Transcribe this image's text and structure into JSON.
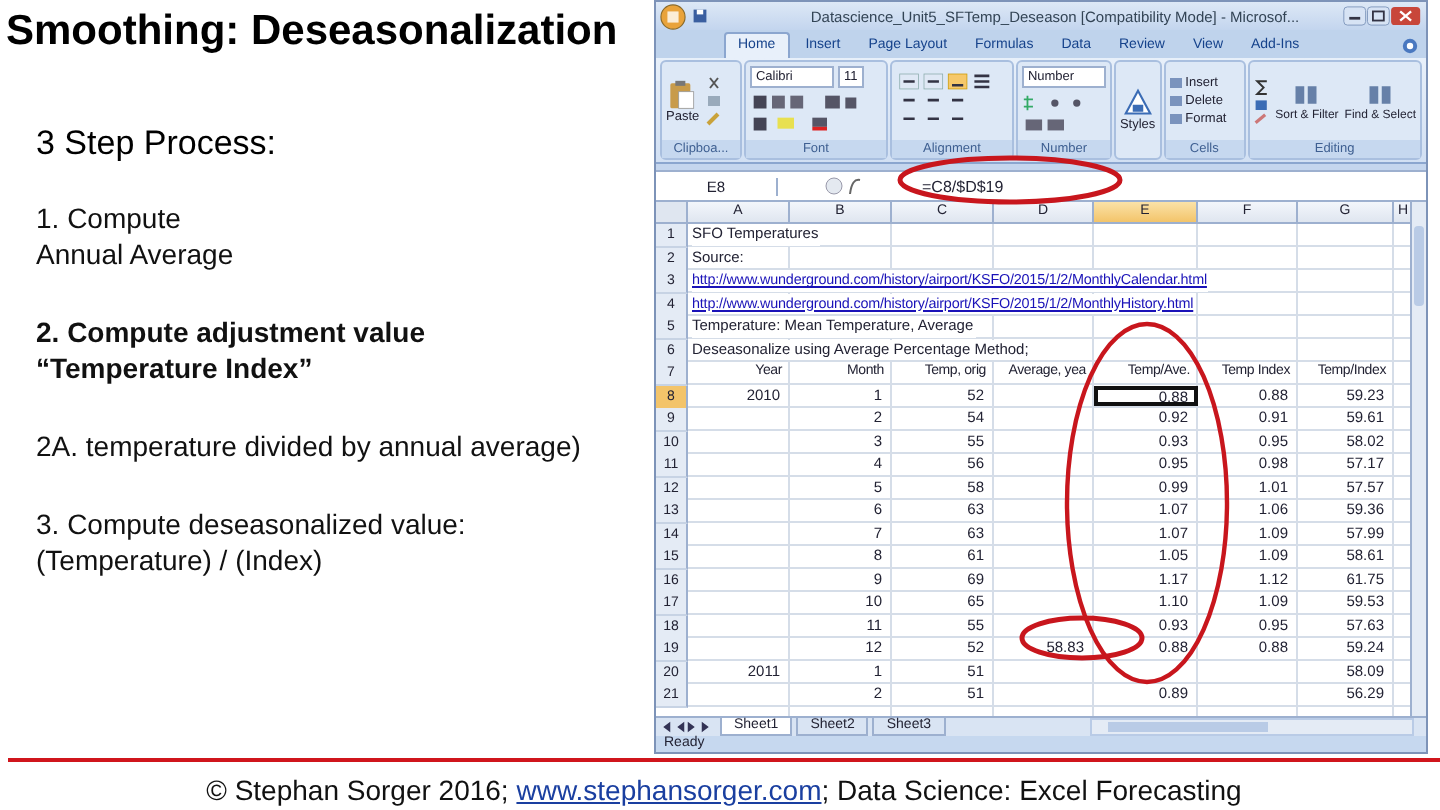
{
  "slide": {
    "title": "Smoothing: Deseasonalization",
    "heading": "3 Step Process:",
    "steps": [
      {
        "lines": [
          "1. Compute",
          "Annual Average"
        ],
        "bold": false
      },
      {
        "lines": [
          "2. Compute adjustment value",
          "“Temperature Index”"
        ],
        "bold": true
      },
      {
        "lines": [
          "2A. temperature divided by annual average)"
        ],
        "bold": false
      },
      {
        "lines": [
          "3. Compute deseasonalized value:",
          "(Temperature) /  (Index)"
        ],
        "bold": false
      }
    ]
  },
  "excel": {
    "title": "Datascience_Unit5_SFTemp_Deseason  [Compatibility Mode] - Microsof...",
    "tabs": [
      {
        "label": "Home",
        "selected": true
      },
      {
        "label": "Insert",
        "selected": false
      },
      {
        "label": "Page Layout",
        "selected": false
      },
      {
        "label": "Formulas",
        "selected": false
      },
      {
        "label": "Data",
        "selected": false
      },
      {
        "label": "Review",
        "selected": false
      },
      {
        "label": "View",
        "selected": false
      },
      {
        "label": "Add-Ins",
        "selected": false
      }
    ],
    "ribbon": [
      {
        "kind": "clipboard",
        "label": "Clipboa...",
        "button": "Paste"
      },
      {
        "kind": "font",
        "label": "Font",
        "font": "Calibri",
        "size": "11"
      },
      {
        "kind": "alignment",
        "label": "Alignment"
      },
      {
        "kind": "number",
        "label": "Number",
        "format": "Number"
      },
      {
        "kind": "styles",
        "button": "Styles"
      },
      {
        "kind": "cells",
        "label": "Cells",
        "buttons": [
          "Insert",
          "Delete",
          "Format"
        ]
      },
      {
        "kind": "editing",
        "label": "Editing",
        "buttons": [
          "Sort & Filter",
          "Find & Select"
        ]
      }
    ],
    "name_box": "E8",
    "formula": "=C8/$D$19",
    "columns": [
      {
        "label": "A",
        "selected": false
      },
      {
        "label": "B",
        "selected": false
      },
      {
        "label": "C",
        "selected": false
      },
      {
        "label": "D",
        "selected": false
      },
      {
        "label": "E",
        "selected": true
      },
      {
        "label": "F",
        "selected": false
      },
      {
        "label": "G",
        "selected": false
      },
      {
        "label": "H",
        "selected": false
      }
    ],
    "rows": [
      {
        "n": "1",
        "kind": "note",
        "selected": false,
        "A": "SFO Temperatures"
      },
      {
        "n": "2",
        "kind": "note",
        "selected": false,
        "A": "Source:"
      },
      {
        "n": "3",
        "kind": "link",
        "selected": false,
        "A": "http://www.wunderground.com/history/airport/KSFO/2015/1/2/MonthlyCalendar.html"
      },
      {
        "n": "4",
        "kind": "link",
        "selected": false,
        "A": "http://www.wunderground.com/history/airport/KSFO/2015/1/2/MonthlyHistory.html"
      },
      {
        "n": "5",
        "kind": "note",
        "selected": false,
        "A": "Temperature: Mean Temperature, Average"
      },
      {
        "n": "6",
        "kind": "note",
        "selected": false,
        "A": "Deseasonalize using Average Percentage Method;"
      },
      {
        "n": "7",
        "kind": "header",
        "selected": false,
        "A": "Year",
        "B": "Month",
        "C": "Temp, orig",
        "D": "Average, yea",
        "E": "Temp/Ave.",
        "F": "Temp Index",
        "G": "Temp/Index"
      },
      {
        "n": "8",
        "kind": "values",
        "selected": true,
        "A": "2010",
        "B": "1",
        "C": "52",
        "E": "0.88",
        "F": "0.88",
        "G": "59.23"
      },
      {
        "n": "9",
        "kind": "values",
        "selected": false,
        "B": "2",
        "C": "54",
        "E": "0.92",
        "F": "0.91",
        "G": "59.61"
      },
      {
        "n": "10",
        "kind": "values",
        "selected": false,
        "B": "3",
        "C": "55",
        "E": "0.93",
        "F": "0.95",
        "G": "58.02"
      },
      {
        "n": "11",
        "kind": "values",
        "selected": false,
        "B": "4",
        "C": "56",
        "E": "0.95",
        "F": "0.98",
        "G": "57.17"
      },
      {
        "n": "12",
        "kind": "values",
        "selected": false,
        "B": "5",
        "C": "58",
        "E": "0.99",
        "F": "1.01",
        "G": "57.57"
      },
      {
        "n": "13",
        "kind": "values",
        "selected": false,
        "B": "6",
        "C": "63",
        "E": "1.07",
        "F": "1.06",
        "G": "59.36"
      },
      {
        "n": "14",
        "kind": "values",
        "selected": false,
        "B": "7",
        "C": "63",
        "E": "1.07",
        "F": "1.09",
        "G": "57.99"
      },
      {
        "n": "15",
        "kind": "values",
        "selected": false,
        "B": "8",
        "C": "61",
        "E": "1.05",
        "F": "1.09",
        "G": "58.61"
      },
      {
        "n": "16",
        "kind": "values",
        "selected": false,
        "B": "9",
        "C": "69",
        "E": "1.17",
        "F": "1.12",
        "G": "61.75"
      },
      {
        "n": "17",
        "kind": "values",
        "selected": false,
        "B": "10",
        "C": "65",
        "E": "1.10",
        "F": "1.09",
        "G": "59.53"
      },
      {
        "n": "18",
        "kind": "values",
        "selected": false,
        "B": "11",
        "C": "55",
        "E": "0.93",
        "F": "0.95",
        "G": "57.63"
      },
      {
        "n": "19",
        "kind": "values",
        "selected": false,
        "B": "12",
        "C": "52",
        "D": "58.83",
        "E": "0.88",
        "F": "0.88",
        "G": "59.24"
      },
      {
        "n": "20",
        "kind": "values",
        "selected": false,
        "A": "2011",
        "B": "1",
        "C": "51",
        "G": "58.09"
      },
      {
        "n": "21",
        "kind": "values",
        "selected": false,
        "B": "2",
        "C": "51",
        "E": "0.89",
        "G": "56.29"
      }
    ],
    "sheets": [
      {
        "label": "Sheet1",
        "selected": true
      },
      {
        "label": "Sheet2",
        "selected": false
      },
      {
        "label": "Sheet3",
        "selected": false
      }
    ],
    "status": "Ready"
  },
  "footer": {
    "before": "© Stephan Sorger 2016; ",
    "link": "www.stephansorger.com",
    "after": "; Data Science: Excel Forecasting"
  }
}
